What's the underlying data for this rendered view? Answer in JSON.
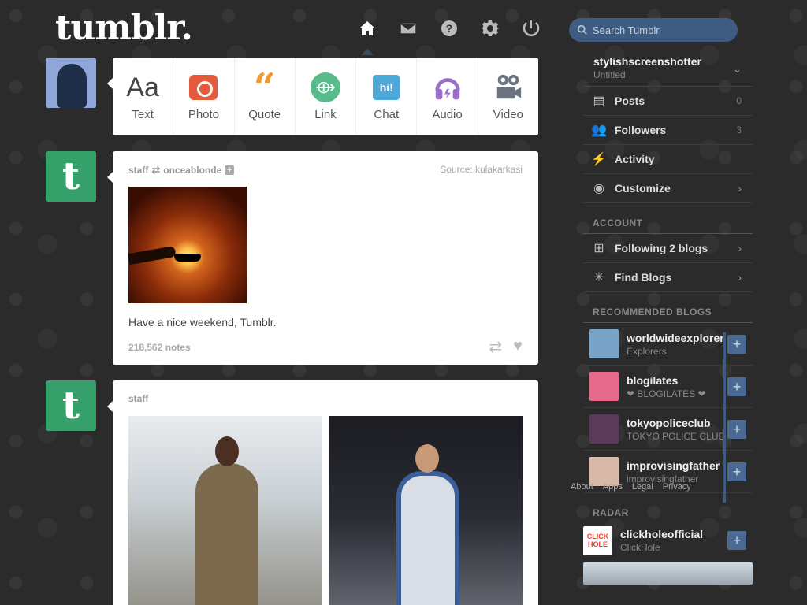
{
  "brand": {
    "logo_text": "tumblr."
  },
  "topnav": [
    {
      "icon": "home-icon",
      "active": true
    },
    {
      "icon": "mail-icon",
      "active": false
    },
    {
      "icon": "help-icon",
      "active": false
    },
    {
      "icon": "gear-icon",
      "active": false
    },
    {
      "icon": "power-icon",
      "active": false
    }
  ],
  "search": {
    "placeholder": "Search Tumblr"
  },
  "composer": {
    "types": [
      "Text",
      "Photo",
      "Quote",
      "Link",
      "Chat",
      "Audio",
      "Video"
    ],
    "chat_badge": "hi!",
    "text_glyph": "Aa",
    "quote_glyph": "“",
    "link_glyph": "⟴"
  },
  "posts": [
    {
      "author": "staff",
      "reblogged_from": "onceablonde",
      "source": "Source: kulakarkasi",
      "caption": "Have a nice weekend, Tumblr.",
      "notes": "218,562 notes",
      "avatar_letter": "t"
    },
    {
      "author": "staff",
      "avatar_letter": "t"
    }
  ],
  "sidebar": {
    "blog_name": "stylishscreenshotter",
    "blog_subtitle": "Untitled",
    "items": [
      {
        "label": "Posts",
        "count": "0",
        "icon": "posts-icon"
      },
      {
        "label": "Followers",
        "count": "3",
        "icon": "followers-icon"
      },
      {
        "label": "Activity",
        "icon": "activity-icon"
      },
      {
        "label": "Customize",
        "icon": "eye-icon"
      }
    ],
    "account_heading": "ACCOUNT",
    "account_items": [
      {
        "label": "Following 2 blogs",
        "icon": "following-icon"
      },
      {
        "label": "Find Blogs",
        "icon": "find-blogs-icon"
      }
    ],
    "recommended_heading": "RECOMMENDED BLOGS",
    "recommended": [
      {
        "name": "worldwideexplorers",
        "subtitle": "Explorers",
        "color": "#7aa3c8"
      },
      {
        "name": "blogilates",
        "subtitle": "❤ BLOGILATES ❤",
        "color": "#e56a8c"
      },
      {
        "name": "tokyopoliceclub",
        "subtitle": "TOKYO POLICE CLUB",
        "color": "#5a3a58"
      },
      {
        "name": "improvisingfather",
        "subtitle": "improvisingfather",
        "color": "#d8b8a8"
      }
    ],
    "footer_links": [
      "About",
      "Apps",
      "Legal",
      "Privacy"
    ],
    "radar_heading": "RADAR",
    "radar": {
      "name": "clickholeofficial",
      "subtitle": "ClickHole",
      "logo_text": "CLICK HOLE"
    }
  }
}
